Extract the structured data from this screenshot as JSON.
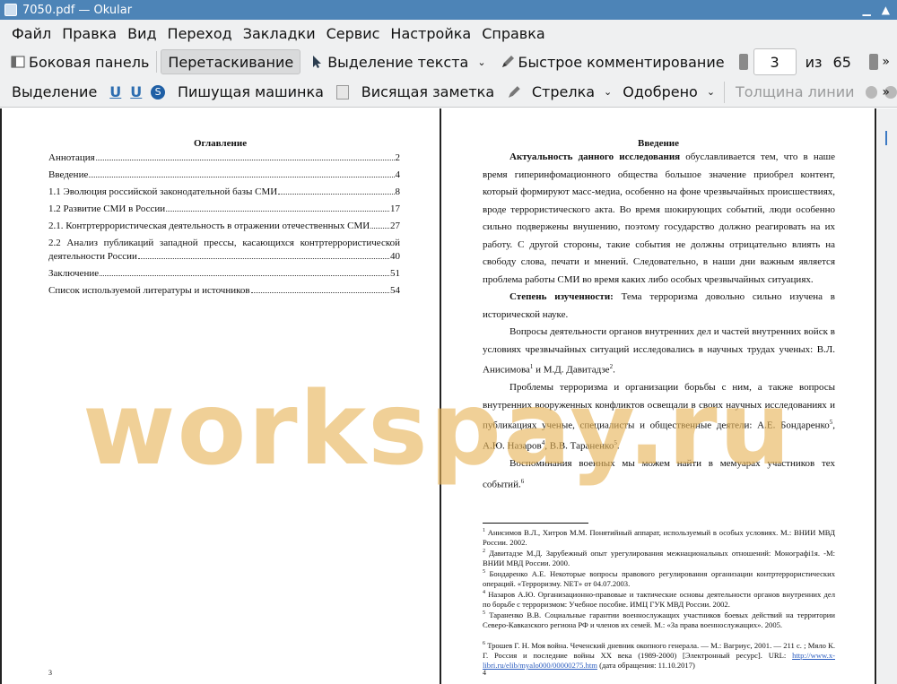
{
  "window": {
    "title": "7050.pdf  — Okular"
  },
  "menu": [
    "Файл",
    "Правка",
    "Вид",
    "Переход",
    "Закладки",
    "Сервис",
    "Настройка",
    "Справка"
  ],
  "toolbar1": {
    "sidebar": "Боковая панель",
    "drag": "Перетаскивание",
    "text_select": "Выделение текста",
    "quick_comment": "Быстрое комментирование",
    "page_current": "3",
    "page_of": "из",
    "page_total": "65"
  },
  "toolbar2": {
    "highlight": "Выделение",
    "typewriter": "Пишущая машинка",
    "sticky": "Висящая заметка",
    "arrow": "Стрелка",
    "approved": "Одобрено",
    "line_width": "Толщина линии"
  },
  "left_page": {
    "heading": "Оглавление",
    "toc": [
      {
        "text": "Аннотация",
        "page": "2"
      },
      {
        "text": "Введение",
        "page": "4"
      },
      {
        "text": "1.1 Эволюция российской законодательной базы СМИ",
        "page": "8"
      },
      {
        "text": "1.2 Развитие СМИ в России",
        "page": "17"
      },
      {
        "text": "2.1. Контртеррористическая деятельность в отражении отечественных СМИ",
        "page": "27"
      },
      {
        "text": "2.2 Анализ публикаций западной прессы, касающихся контртеррористической",
        "text2": "деятельности России",
        "page": "40"
      },
      {
        "text": "Заключение",
        "page": "51"
      },
      {
        "text": "Список используемой литературы и источников",
        "page": "54"
      }
    ],
    "page_number": "3"
  },
  "right_page": {
    "heading": "Введение",
    "p1_bold": "Актуальность данного исследования",
    "p1": " обуславливается тем, что в наше время гиперинфомационного общества большое значение приобрел контент, который формируют масс-медиа, особенно на фоне чрезвычайных происшествиях, вроде террористического акта. Во время шокирующих событий, люди особенно сильно подвержены внушению, поэтому государство должно реагировать на их работу. С другой стороны, такие события не должны отрицательно влиять на свободу слова, печати и мнений. Следовательно, в наши дни важным является проблема работы СМИ во время каких либо особых чрезвычайных ситуациях.",
    "p2_bold": "Степень изученности:",
    "p2": " Тема терроризма довольно сильно изучена в исторической науке.",
    "p3a": "Вопросы деятельности органов внутренних дел и частей внутренних войск в условиях чрезвычайных ситуаций исследовались в научных трудах ученых: В.Л. Анисимова",
    "p3b": " и М.Д. Давитадзе",
    "p3c": ".",
    "p4a": "Проблемы терроризма и организации борьбы с ним, а также вопросы внутренних вооруженных конфликтов освещали в своих научных исследованиях и публикациях ученые, специалисты и общественные деятели: А.Е. Бондаренко",
    "p4b": ", А.Ю. Назаров",
    "p4c": ", В.В. Тараненко",
    "p4d": ".",
    "p5": "Воспоминания военных мы можем найти в мемуарах участников тех событий.",
    "sup": [
      "1",
      "2",
      "5",
      "4",
      "5",
      "6"
    ],
    "footnotes": [
      "Анисимов В.Л., Хитров М.М. Понятийный аппарат, используемый в особых условиях. М.: ВНИИ МВД России. 2002.",
      "Давитадзе М.Д. Зарубежный опыт урегулирования межнациональных отношений: Монографі1я. -М: ВНИИ МВД России. 2000.",
      "Бондаренко А.Е. Некоторые вопросы правового регулирования организации контртеррористических операций. «Терроризму. NET» от 04.07.2003.",
      "Назаров А.Ю. Организационно-правовые и тактические основы деятельности органов внутренних дел по борьбе с терроризмом: Учебное пособие. ИМЦ ГУК МВД России. 2002.",
      "Тараненко В.В. Социальные гарантии военнослужащих участников боевых действий на территории Северо-Кавказского региона РФ и членов их семей. М.: «За права военнослужащих». 2005.",
      "Трошев Г. Н. Моя война. Чеченский дневник окопного генерала. — М.: Вагриус, 2001. — 211 с. ; Мяло К. Г. Россия и последние войны XX века (1989-2000) [Электронный ресурс]. URL: "
    ],
    "fn_link": "http://www.x-libri.ru/elib/myalo000/00000275.htm",
    "fn_after": " (дата обращения: 11.10.2017)",
    "page_number": "4"
  },
  "watermark": "workspay.ru",
  "colors": {
    "titlebar": "#4d84b7",
    "watermark": "#e7b458",
    "chrome": "#eff0f1"
  }
}
